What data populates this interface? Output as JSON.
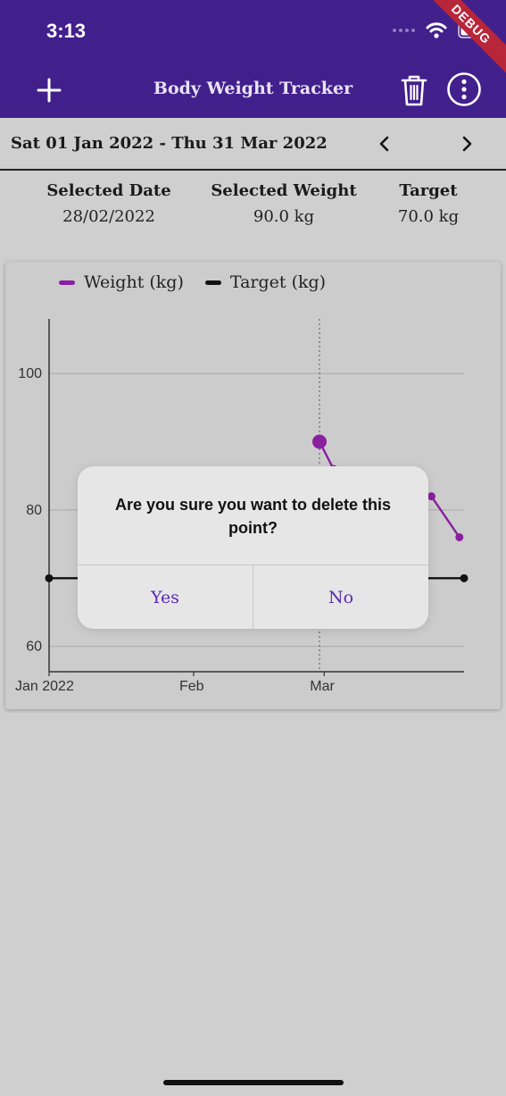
{
  "status_bar": {
    "time": "3:13",
    "debug_label": "DEBUG"
  },
  "app_bar": {
    "title": "Body Weight Tracker"
  },
  "date_range": {
    "label": "Sat 01 Jan 2022 - Thu 31 Mar 2022"
  },
  "summary": {
    "selected_date_label": "Selected Date",
    "selected_date_value": "28/02/2022",
    "selected_weight_label": "Selected Weight",
    "selected_weight_value": "90.0 kg",
    "target_label": "Target",
    "target_value": "70.0 kg"
  },
  "legend": {
    "weight_label": "Weight (kg)",
    "target_label": "Target (kg)"
  },
  "colors": {
    "app_bar": "#42208c",
    "weight_series": "#8a1fa0",
    "target_series": "#111111",
    "accent": "#5a2bb3"
  },
  "chart_data": {
    "type": "line",
    "x_tick_labels": [
      "Jan 2022",
      "Feb",
      "Mar"
    ],
    "y_tick_labels": [
      "100",
      "80",
      "60"
    ],
    "y_ticks": [
      100,
      80,
      60
    ],
    "ylim": [
      56.3,
      108
    ],
    "xlim": [
      "2022-01-01",
      "2022-03-31"
    ],
    "grid": "horizontal",
    "legend_position": "top",
    "series": [
      {
        "name": "Weight (kg)",
        "color": "#8a1fa0",
        "points": [
          {
            "x": "2022-02-28",
            "y": 90
          },
          {
            "x": "2022-03-03",
            "y": 86
          },
          {
            "x": "2022-03-24",
            "y": 82
          },
          {
            "x": "2022-03-30",
            "y": 76
          }
        ]
      },
      {
        "name": "Target (kg)",
        "color": "#111111",
        "points": [
          {
            "x": "2022-01-01",
            "y": 70
          },
          {
            "x": "2022-03-31",
            "y": 70
          }
        ]
      }
    ],
    "selected_point": {
      "x": "2022-02-28",
      "y": 90
    }
  },
  "dialog": {
    "message": "Are you sure you want to delete this point?",
    "yes_label": "Yes",
    "no_label": "No"
  }
}
